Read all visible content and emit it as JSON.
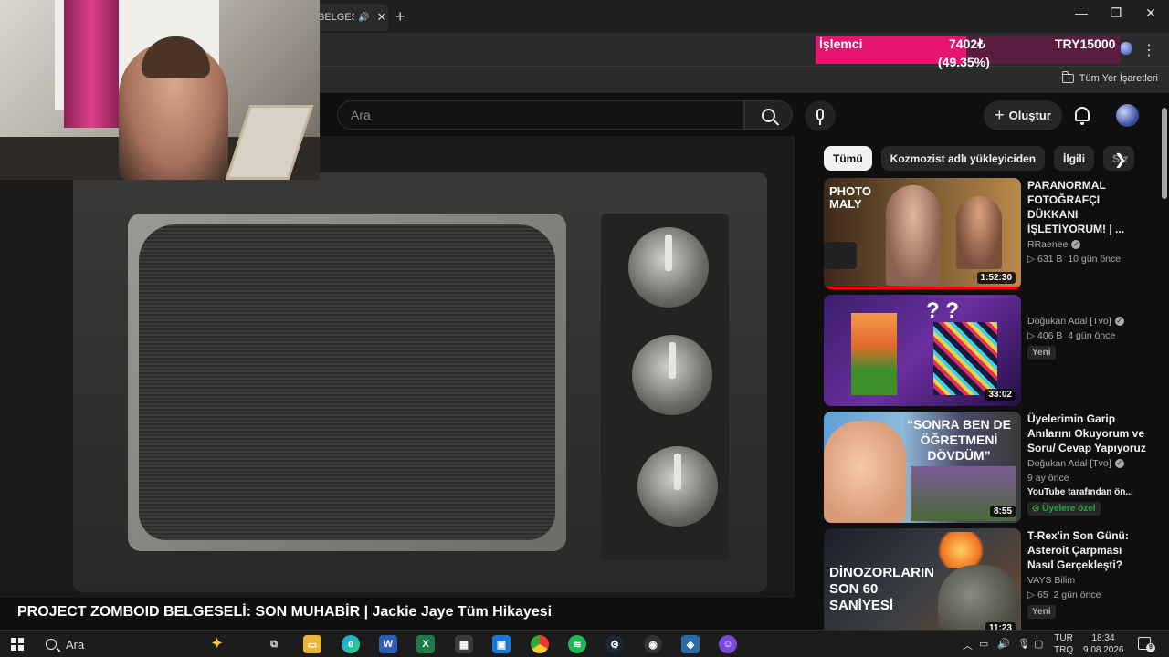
{
  "browser": {
    "tab_title": "BELGESEL",
    "new_tab": "+",
    "minimize": "—",
    "maximize": "❐",
    "close": "✕",
    "bookmarks_all": "Tüm Yer İşaretleri"
  },
  "donation": {
    "label": "İşlemci",
    "amount": "7402₺",
    "goal": "TRY15000",
    "percent": "(49.35%)",
    "progress_fraction": 0.4935
  },
  "header": {
    "search_placeholder": "Ara",
    "create_label": "Oluştur"
  },
  "video": {
    "title": "PROJECT ZOMBOID BELGESELİ: SON MUHABİR | Jackie Jaye Tüm Hikayesi"
  },
  "chips": [
    "Tümü",
    "Kozmozist adlı yükleyiciden",
    "İlgili",
    "Siz"
  ],
  "recommendations": [
    {
      "title": "PARANORMAL FOTOĞRAFÇI DÜKKANI İŞLETİYORUM! | ...",
      "channel": "RRaenee",
      "views": "631 B",
      "age": "10 gün önce",
      "duration": "1:52:30",
      "thumb_text": "PHOTO MALY",
      "badge": "",
      "by": ""
    },
    {
      "title": "",
      "channel": "Doğukan Adal [Tvo]",
      "views": "406 B",
      "age": "4 gün önce",
      "duration": "33:02",
      "thumb_text": "",
      "badge": "Yeni",
      "by": ""
    },
    {
      "title": "Üyelerimin Garip Anılarını Okuyorum ve Soru/ Cevap Yapıyoruz",
      "channel": "Doğukan Adal [Tvo]",
      "views": "",
      "age": "9 ay önce",
      "duration": "8:55",
      "thumb_text": "“SONRA BEN DE ÖĞRETMENİ DÖVDÜM”",
      "badge": "Üyelere özel",
      "by": "YouTube tarafından ön..."
    },
    {
      "title": "T-Rex'in Son Günü: Asteroit Çarpması Nasıl Gerçekleşti?",
      "channel": "VAYS Bilim",
      "views": "65",
      "age": "2 gün önce",
      "duration": "11:23",
      "thumb_text": "DİNOZORLARIN SON 60 SANİYESİ",
      "badge": "Yeni",
      "by": ""
    }
  ],
  "taskbar": {
    "search_label": "Ara",
    "lang_line1": "TUR",
    "lang_line2": "TRQ",
    "time": "18:34",
    "date": "9.08.2026",
    "notification_count": "9"
  }
}
